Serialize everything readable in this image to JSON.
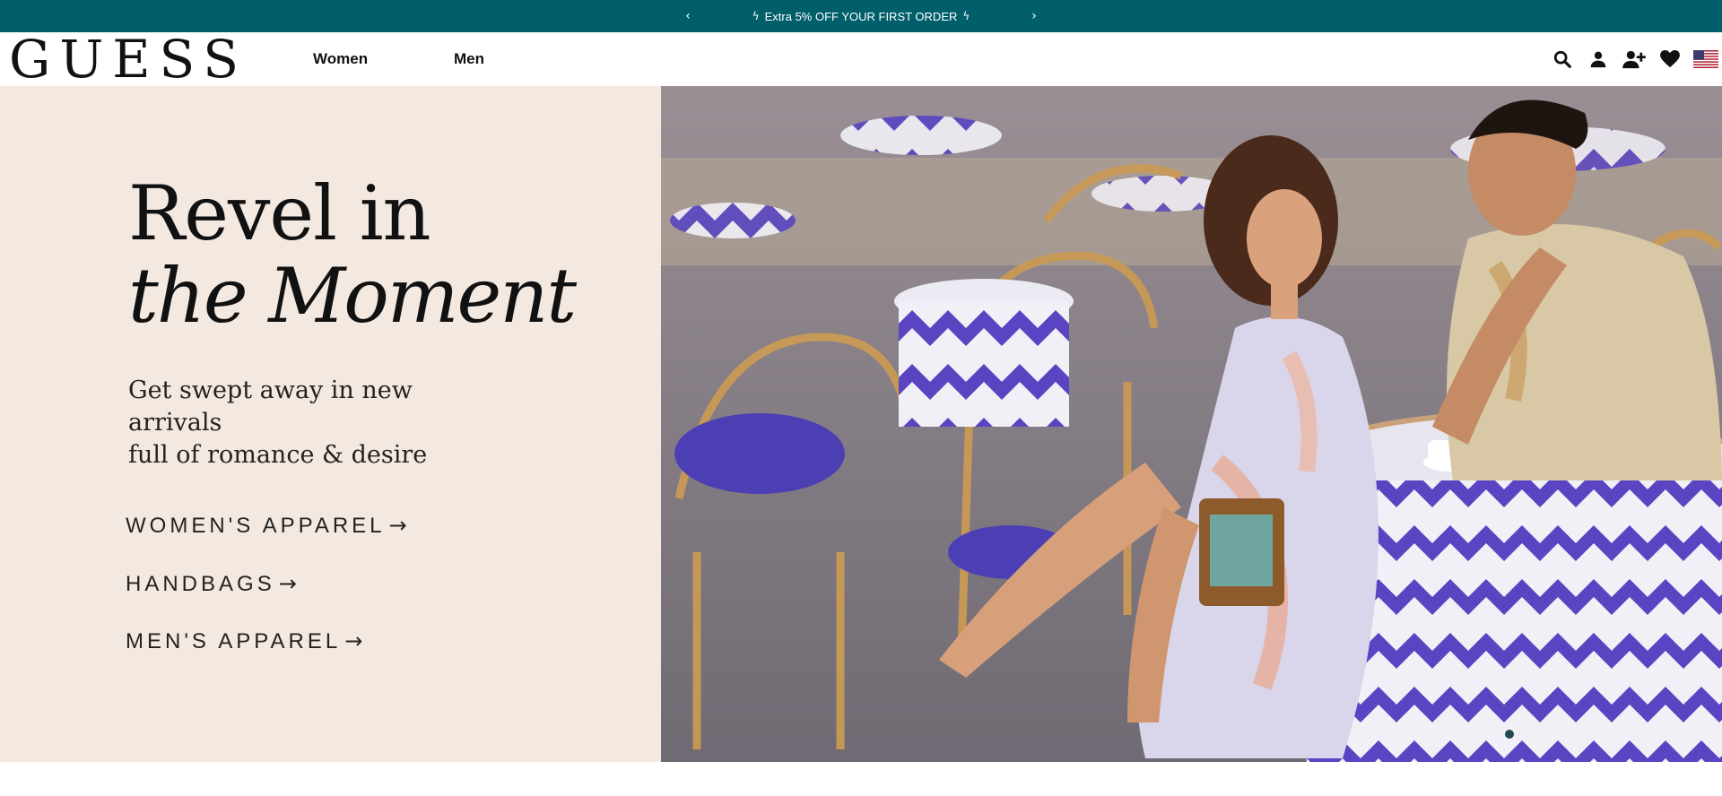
{
  "promo": {
    "prev_icon": "chevron-left-icon",
    "next_icon": "chevron-right-icon",
    "text": "Extra 5% OFF YOUR FIRST ORDER",
    "left_decor_icon": "lightning-icon",
    "right_decor_icon": "lightning-icon",
    "prev_glyph": "‹",
    "next_glyph": "›",
    "background": "#005f6b"
  },
  "header": {
    "logo": "GUESS",
    "nav": [
      {
        "label": "Women"
      },
      {
        "label": "Men"
      }
    ],
    "icons": [
      "search-icon",
      "account-icon",
      "add-user-icon",
      "wishlist-heart-icon",
      "us-flag-icon"
    ]
  },
  "hero": {
    "title_line1": "Revel in",
    "title_line2": "the Moment",
    "subtitle_line1": "Get swept away in new arrivals",
    "subtitle_line2": "full of romance & desire",
    "ctas": [
      {
        "label": "WOMEN'S APPAREL",
        "arrow": "→"
      },
      {
        "label": "HANDBAGS",
        "arrow": "→"
      },
      {
        "label": "MEN'S APPAREL",
        "arrow": "→"
      }
    ],
    "background": "#f4e9e1",
    "image_subject": "couple-at-cafe-photo"
  }
}
